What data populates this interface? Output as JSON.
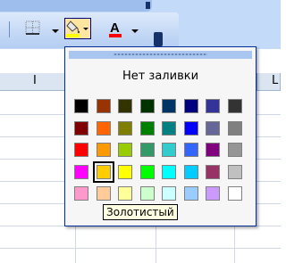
{
  "fill_popup": {
    "no_fill_label": "Нет заливки",
    "selected_color_name": "Золотистый",
    "swatch_rows": [
      [
        "#000000",
        "#993300",
        "#333300",
        "#003300",
        "#003366",
        "#000080",
        "#333399",
        "#333333"
      ],
      [
        "#800000",
        "#ff6600",
        "#808000",
        "#008000",
        "#008080",
        "#0000ff",
        "#666699",
        "#808080"
      ],
      [
        "#ff0000",
        "#ff9900",
        "#99cc00",
        "#339966",
        "#33cccc",
        "#3366ff",
        "#800080",
        "#969696"
      ],
      [
        "#ff00ff",
        "#ffcc00",
        "#ffff00",
        "#00ff00",
        "#00ffff",
        "#00ccff",
        "#993366",
        "#c0c0c0"
      ],
      [
        "#ff99cc",
        "#ffcc99",
        "#ffff99",
        "#ccffcc",
        "#ccffff",
        "#99ccff",
        "#cc99ff",
        "#ffffff"
      ]
    ],
    "selected": {
      "row": 3,
      "col": 1
    }
  },
  "toolbar": {
    "fill_color_swatch": "#ffff00",
    "font_color_swatch": "#ff0000",
    "font_color_letter": "A"
  },
  "sheet": {
    "column_letters": [
      "I",
      "L"
    ]
  }
}
